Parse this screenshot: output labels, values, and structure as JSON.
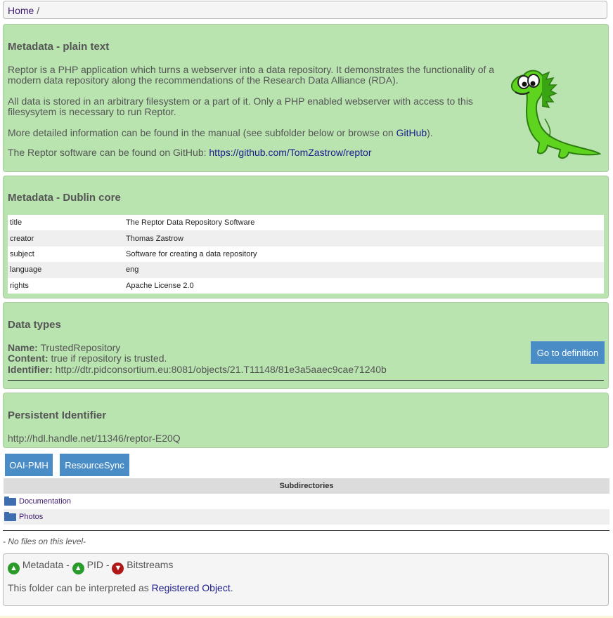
{
  "breadcrumb": {
    "home": "Home",
    "sep": "/"
  },
  "plain_text": {
    "title": "Metadata - plain text",
    "p1": "Reptor is a PHP application which turns a webserver into a data repository. It demonstrates the functionality of a modern data repository along the recommendations of the Research Data Alliance (RDA).",
    "p2": "All data is stored in an arbitrary filesystem or a part of it. Only a PHP enabled webserver with access to this filesysytem is necessary to run Reptor.",
    "p3_pre": "More detailed information can be found in the manual (see subfolder below or browse on ",
    "p3_link": "GitHub",
    "p3_post": ").",
    "p4_pre": "The Reptor software can be found on GitHub: ",
    "p4_link": "https://github.com/TomZastrow/reptor"
  },
  "dublin_core": {
    "title": "Metadata - Dublin core",
    "rows": [
      {
        "key": "title",
        "value": "The Reptor Data Repository Software"
      },
      {
        "key": "creator",
        "value": "Thomas Zastrow"
      },
      {
        "key": "subject",
        "value": "Software for creating a data repository"
      },
      {
        "key": "language",
        "value": "eng"
      },
      {
        "key": "rights",
        "value": "Apache License 2.0"
      }
    ]
  },
  "data_types": {
    "title": "Data types",
    "name_label": "Name:",
    "name_value": "TrustedRepository",
    "content_label": "Content:",
    "content_value": "true if repository is trusted.",
    "identifier_label": "Identifier:",
    "identifier_value": "http://dtr.pidconsortium.eu:8081/objects/21.T11148/81e3a5aaec9cae71240b",
    "button": "Go to definition"
  },
  "pid": {
    "title": "Persistent Identifier",
    "value": "http://hdl.handle.net/11346/reptor-E20Q"
  },
  "buttons": {
    "oai": "OAI-PMH",
    "resourcesync": "ResourceSync"
  },
  "subdirectories": {
    "header": "Subdirectories",
    "items": [
      "Documentation",
      "Photos"
    ]
  },
  "no_files": "- No files on this level-",
  "status": {
    "metadata": "Metadata -",
    "pid": "PID -",
    "bitstreams": "Bitstreams",
    "text_pre": "This folder can be interpreted as ",
    "text_link": "Registered Object",
    "text_post": "."
  },
  "colors": {
    "panel_green": "#b9e4b0",
    "button_blue": "#4a8cc6",
    "thumb_up": "#2a9a2a",
    "thumb_down": "#b01818"
  },
  "icons": {
    "folder": "folder-icon",
    "thumb_up": "thumbs-up-icon",
    "thumb_down": "thumbs-down-icon",
    "mascot": "dinosaur-mascot"
  }
}
